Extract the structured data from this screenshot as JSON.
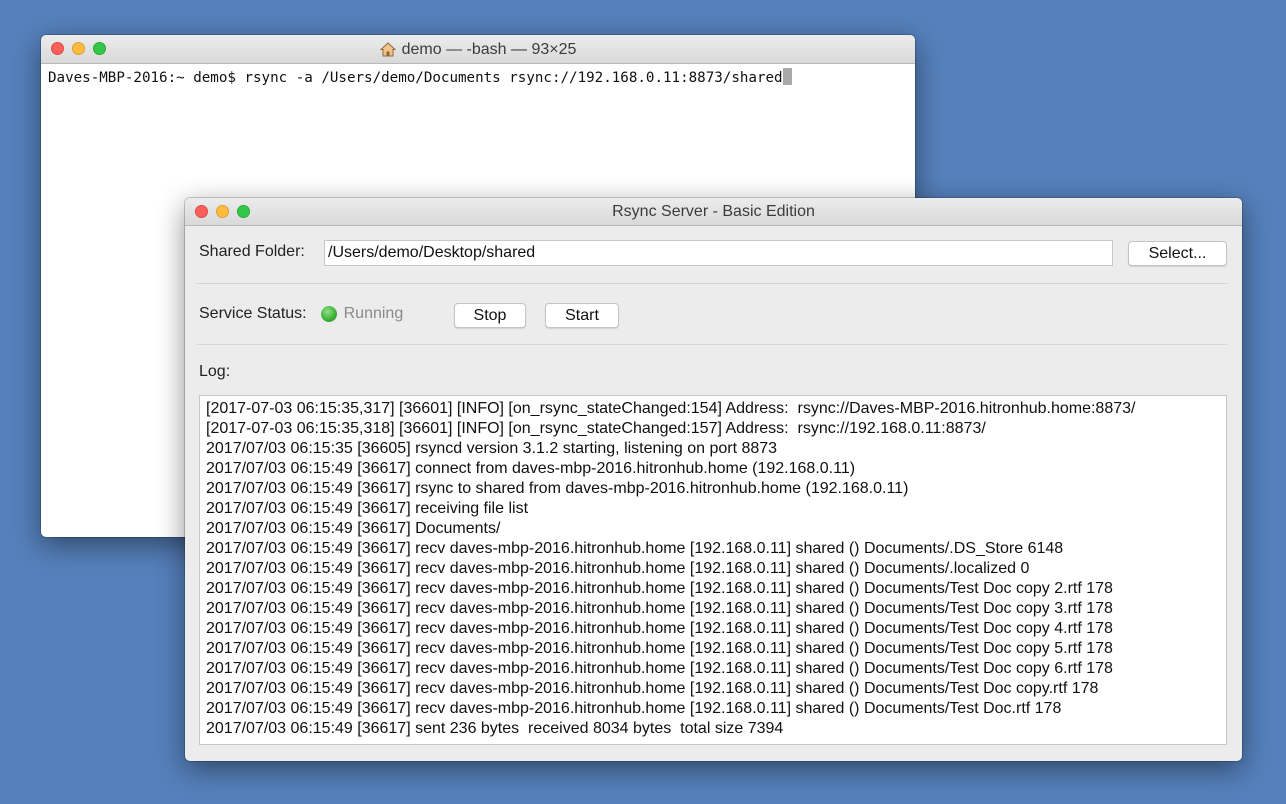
{
  "terminal": {
    "title": "demo — -bash — 93×25",
    "prompt": "Daves-MBP-2016:~ demo$ ",
    "command": "rsync -a /Users/demo/Documents rsync://192.168.0.11:8873/shared"
  },
  "rsync_window": {
    "title": "Rsync Server - Basic Edition",
    "shared_folder_label": "Shared Folder:",
    "shared_folder_value": "/Users/demo/Desktop/shared",
    "select_button": "Select...",
    "service_status_label": "Service Status:",
    "status_text": "Running",
    "status_color": "#3dae35",
    "stop_button": "Stop",
    "start_button": "Start",
    "log_label": "Log:",
    "log_lines": [
      "[2017-07-03 06:15:35,317] [36601] [INFO] [on_rsync_stateChanged:154] Address:  rsync://Daves-MBP-2016.hitronhub.home:8873/",
      "[2017-07-03 06:15:35,318] [36601] [INFO] [on_rsync_stateChanged:157] Address:  rsync://192.168.0.11:8873/",
      "2017/07/03 06:15:35 [36605] rsyncd version 3.1.2 starting, listening on port 8873",
      "2017/07/03 06:15:49 [36617] connect from daves-mbp-2016.hitronhub.home (192.168.0.11)",
      "2017/07/03 06:15:49 [36617] rsync to shared from daves-mbp-2016.hitronhub.home (192.168.0.11)",
      "2017/07/03 06:15:49 [36617] receiving file list",
      "2017/07/03 06:15:49 [36617] Documents/",
      "2017/07/03 06:15:49 [36617] recv daves-mbp-2016.hitronhub.home [192.168.0.11] shared () Documents/.DS_Store 6148",
      "2017/07/03 06:15:49 [36617] recv daves-mbp-2016.hitronhub.home [192.168.0.11] shared () Documents/.localized 0",
      "2017/07/03 06:15:49 [36617] recv daves-mbp-2016.hitronhub.home [192.168.0.11] shared () Documents/Test Doc copy 2.rtf 178",
      "2017/07/03 06:15:49 [36617] recv daves-mbp-2016.hitronhub.home [192.168.0.11] shared () Documents/Test Doc copy 3.rtf 178",
      "2017/07/03 06:15:49 [36617] recv daves-mbp-2016.hitronhub.home [192.168.0.11] shared () Documents/Test Doc copy 4.rtf 178",
      "2017/07/03 06:15:49 [36617] recv daves-mbp-2016.hitronhub.home [192.168.0.11] shared () Documents/Test Doc copy 5.rtf 178",
      "2017/07/03 06:15:49 [36617] recv daves-mbp-2016.hitronhub.home [192.168.0.11] shared () Documents/Test Doc copy 6.rtf 178",
      "2017/07/03 06:15:49 [36617] recv daves-mbp-2016.hitronhub.home [192.168.0.11] shared () Documents/Test Doc copy.rtf 178",
      "2017/07/03 06:15:49 [36617] recv daves-mbp-2016.hitronhub.home [192.168.0.11] shared () Documents/Test Doc.rtf 178",
      "2017/07/03 06:15:49 [36617] sent 236 bytes  received 8034 bytes  total size 7394"
    ]
  }
}
